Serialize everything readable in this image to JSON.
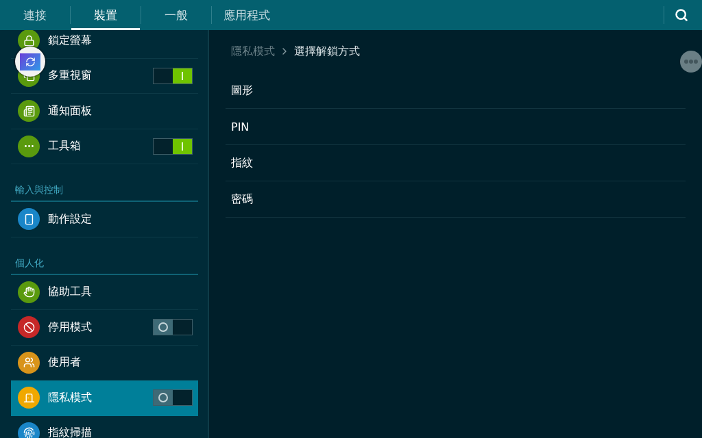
{
  "tabs": [
    {
      "label": "連接",
      "selected": false
    },
    {
      "label": "裝置",
      "selected": true
    },
    {
      "label": "一般",
      "selected": false
    },
    {
      "label": "應用程式",
      "selected": false
    }
  ],
  "sidebar": {
    "items": [
      {
        "kind": "item",
        "label": "鎖定螢幕",
        "color": "#5a9a0e",
        "selected": false
      },
      {
        "kind": "item",
        "label": "多重視窗",
        "color": "#5a9a0e",
        "selected": false,
        "toggle": {
          "on": true
        }
      },
      {
        "kind": "item",
        "label": "通知面板",
        "color": "#5a9a0e",
        "selected": false
      },
      {
        "kind": "item",
        "label": "工具箱",
        "color": "#5a9a0e",
        "selected": false,
        "toggle": {
          "on": true
        }
      },
      {
        "kind": "header",
        "label": "輸入與控制"
      },
      {
        "kind": "item",
        "label": "動作設定",
        "color": "#1a86c8",
        "selected": false
      },
      {
        "kind": "header",
        "label": "個人化"
      },
      {
        "kind": "item",
        "label": "協助工具",
        "color": "#5a9a0e",
        "selected": false
      },
      {
        "kind": "item",
        "label": "停用模式",
        "color": "#c62828",
        "selected": false,
        "toggle": {
          "on": false
        }
      },
      {
        "kind": "item",
        "label": "使用者",
        "color": "#d8941a",
        "selected": false
      },
      {
        "kind": "item",
        "label": "隱私模式",
        "color": "#f0a800",
        "selected": true,
        "toggle": {
          "on": false
        }
      },
      {
        "kind": "item",
        "label": "指紋掃描",
        "color": "#1a86c8",
        "selected": false
      }
    ]
  },
  "breadcrumb": {
    "parent": "隱私模式",
    "current": "選擇解鎖方式"
  },
  "options": [
    "圖形",
    "PIN",
    "指紋",
    "密碼"
  ]
}
